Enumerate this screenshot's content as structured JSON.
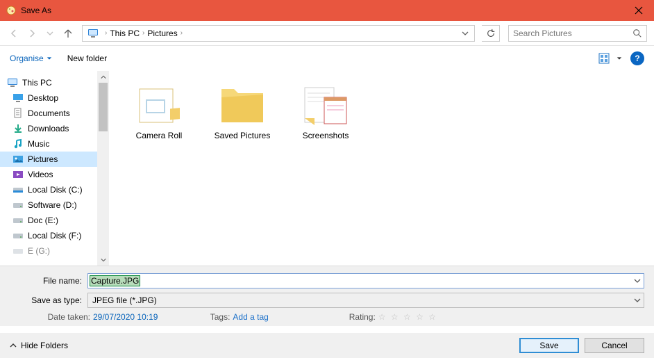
{
  "window": {
    "title": "Save As"
  },
  "breadcrumbs": {
    "root_icon": "pc-icon",
    "items": [
      "This PC",
      "Pictures"
    ]
  },
  "search": {
    "placeholder": "Search Pictures"
  },
  "toolbar": {
    "organise": "Organise",
    "newfolder": "New folder"
  },
  "tree": {
    "root": "This PC",
    "items": [
      {
        "label": "Desktop",
        "icon": "desktop"
      },
      {
        "label": "Documents",
        "icon": "documents"
      },
      {
        "label": "Downloads",
        "icon": "downloads"
      },
      {
        "label": "Music",
        "icon": "music"
      },
      {
        "label": "Pictures",
        "icon": "pictures",
        "selected": true
      },
      {
        "label": "Videos",
        "icon": "videos"
      },
      {
        "label": "Local Disk (C:)",
        "icon": "drive"
      },
      {
        "label": "Software (D:)",
        "icon": "drive"
      },
      {
        "label": "Doc (E:)",
        "icon": "drive"
      },
      {
        "label": "Local Disk (F:)",
        "icon": "drive"
      },
      {
        "label": "E (G:)",
        "icon": "drive"
      }
    ]
  },
  "folders": [
    {
      "name": "Camera Roll",
      "kind": "album"
    },
    {
      "name": "Saved Pictures",
      "kind": "plain"
    },
    {
      "name": "Screenshots",
      "kind": "screens"
    }
  ],
  "form": {
    "filename_label": "File name:",
    "filename_value": "Capture.JPG",
    "type_label": "Save as type:",
    "type_value": "JPEG file (*.JPG)"
  },
  "meta": {
    "date_label": "Date taken:",
    "date_value": "29/07/2020 10:19",
    "tags_label": "Tags:",
    "tags_value": "Add a tag",
    "rating_label": "Rating:"
  },
  "footer": {
    "hide": "Hide Folders",
    "save": "Save",
    "cancel": "Cancel"
  }
}
